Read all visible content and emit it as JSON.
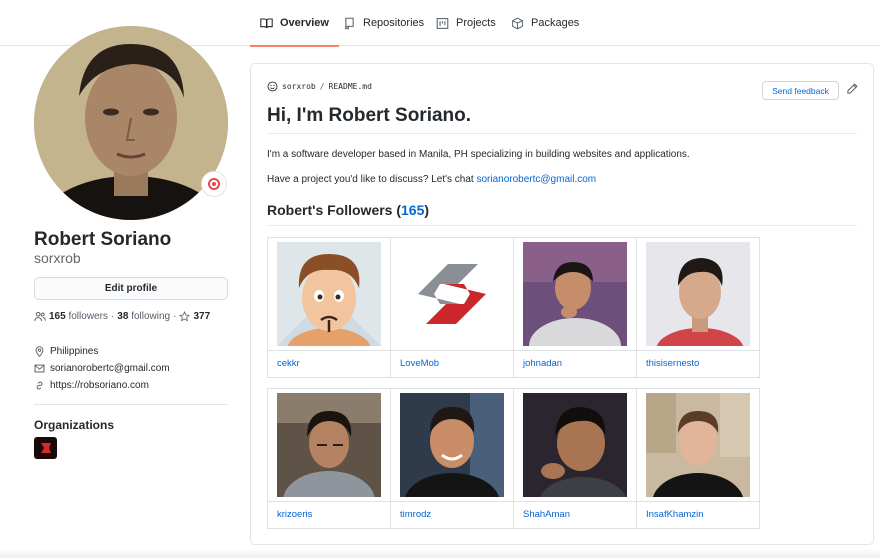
{
  "tabs": [
    {
      "label": "Overview",
      "icon": "book-icon",
      "active": true
    },
    {
      "label": "Repositories",
      "icon": "repo-icon",
      "active": false
    },
    {
      "label": "Projects",
      "icon": "project-icon",
      "active": false
    },
    {
      "label": "Packages",
      "icon": "package-icon",
      "active": false
    }
  ],
  "profile": {
    "fullname": "Robert Soriano",
    "username": "sorxrob",
    "edit_label": "Edit profile",
    "followers_count": "165",
    "followers_label": "followers",
    "following_count": "38",
    "following_label": "following",
    "stars_count": "377",
    "location": "Philippines",
    "email": "sorianorobertc@gmail.com",
    "website": "https://robsoriano.com",
    "organizations_title": "Organizations"
  },
  "readme": {
    "owner": "sorxrob",
    "file": "README.md",
    "feedback_label": "Send feedback",
    "heading": "Hi, I'm Robert Soriano.",
    "intro": "I'm a software developer based in Manila, PH specializing in building websites and applications.",
    "contact_prefix": "Have a project you'd like to discuss? Let's chat ",
    "contact_email": "sorianorobertc@gmail.com",
    "followers_heading_prefix": "Robert's Followers (",
    "followers_heading_count": "165",
    "followers_heading_suffix": ")",
    "followers": [
      {
        "name": "cekkr"
      },
      {
        "name": "LoveMob"
      },
      {
        "name": "johnadan"
      },
      {
        "name": "thisisernesto"
      },
      {
        "name": "krizoeris"
      },
      {
        "name": "timrodz"
      },
      {
        "name": "ShahAman"
      },
      {
        "name": "InsafKhamzin"
      }
    ]
  },
  "colors": {
    "accent_tab": "#f9826c",
    "link": "#0366d6",
    "text": "#24292e"
  }
}
